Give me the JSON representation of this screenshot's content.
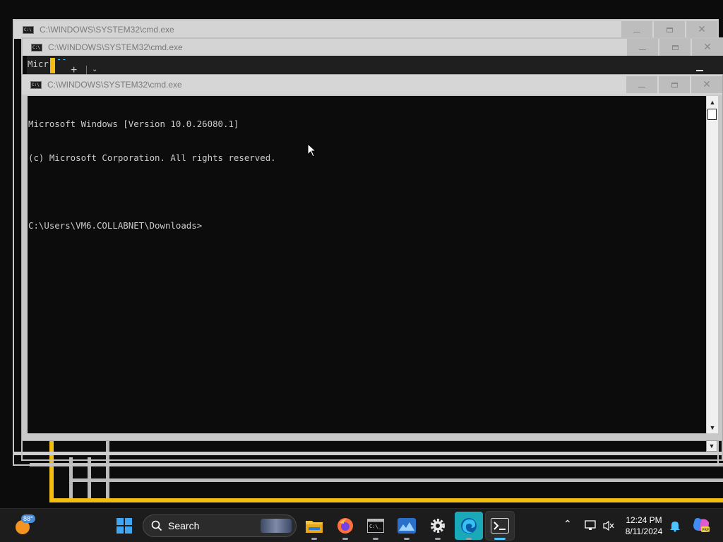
{
  "windows": {
    "back1": {
      "title": "C:\\WINDOWS\\SYSTEM32\\cmd.exe"
    },
    "back2": {
      "title": "C:\\WINDOWS\\SYSTEM32\\cmd.exe",
      "peek_text": "Micr",
      "peek_dashes": "--"
    },
    "main": {
      "title": "C:\\WINDOWS\\SYSTEM32\\cmd.exe",
      "lines": [
        "Microsoft Windows [Version 10.0.26080.1]",
        "(c) Microsoft Corporation. All rights reserved.",
        "",
        "C:\\Users\\VM6.COLLABNET\\Downloads>"
      ]
    },
    "buttons": {
      "minimize": "minimize-icon",
      "maximize": "maximize-icon",
      "close": "close-icon"
    }
  },
  "taskbar": {
    "weather": {
      "temp": "88°"
    },
    "search": {
      "label": "Search"
    },
    "apps": [
      {
        "name": "file-explorer",
        "icon": "folder-icon"
      },
      {
        "name": "firefox",
        "icon": "firefox-icon"
      },
      {
        "name": "command-prompt",
        "icon": "cmd-icon"
      },
      {
        "name": "photos",
        "icon": "photos-icon"
      },
      {
        "name": "settings",
        "icon": "gear-icon"
      },
      {
        "name": "edge",
        "icon": "edge-icon"
      },
      {
        "name": "terminal",
        "icon": "terminal-icon"
      }
    ],
    "tray": {
      "time": "12:24 PM",
      "date": "8/11/2024"
    }
  },
  "colors": {
    "console_bg": "#0c0c0c",
    "console_fg": "#cccccc",
    "accent_yellow": "#f4bd12",
    "taskbar_bg": "#1c1c1c",
    "active_indicator": "#4cc2ff"
  }
}
